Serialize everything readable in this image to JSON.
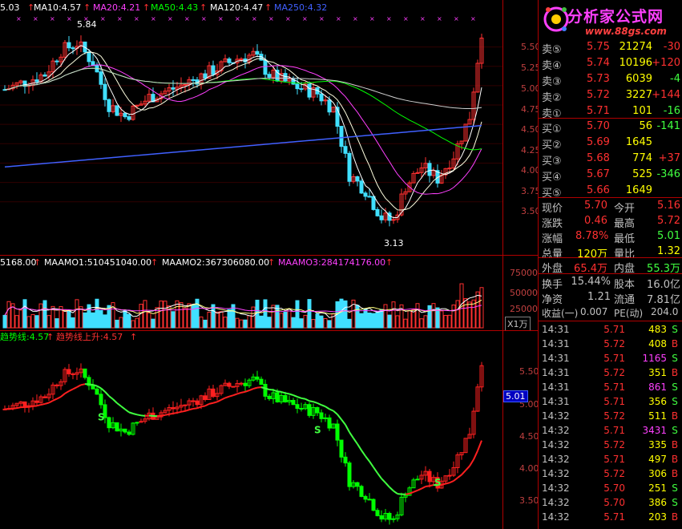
{
  "colors": {
    "up": "#ff3030",
    "down": "#40e0ff",
    "green": "#00ff00",
    "ma5": "#ffffff",
    "ma10": "#ffff00",
    "ma20": "#ff40ff",
    "ma50": "#00ff00",
    "ma120": "#ffffff",
    "ma250": "#4060ff"
  },
  "main_chart": {
    "legend": [
      {
        "label": "5.03",
        "color": "#ffffff"
      },
      {
        "label": "MA10:4.57",
        "color": "#ffffff"
      },
      {
        "label": "MA20:4.21",
        "color": "#ff40ff"
      },
      {
        "label": "MA50:4.43",
        "color": "#00ff00"
      },
      {
        "label": "MA120:4.47",
        "color": "#ffffff"
      },
      {
        "label": "MA250:4.32",
        "color": "#4060ff"
      }
    ],
    "high_marker": "5.84",
    "low_marker": "3.13",
    "axis_ticks": [
      "5.50",
      "5.25",
      "5.00",
      "4.75",
      "4.50",
      "4.25",
      "4.00",
      "3.75",
      "3.50"
    ]
  },
  "volume_chart": {
    "legend": [
      {
        "label": "5168.00",
        "color": "#ffffff"
      },
      {
        "label": "MAAMO1:510451040.00",
        "color": "#ffffff"
      },
      {
        "label": "MAAMO2:367306080.00",
        "color": "#ffffff"
      },
      {
        "label": "MAAMO3:284174176.00",
        "color": "#ff40ff"
      }
    ],
    "axis_ticks": [
      "75000",
      "50000",
      "25000"
    ],
    "unit": "X1万"
  },
  "trend_chart": {
    "legend": [
      {
        "label": "趋势线:4.57",
        "color": "#00ff00"
      },
      {
        "label": "趋势线上升:4.57",
        "color": "#ff3030"
      }
    ],
    "axis_ticks": [
      "5.50",
      "5.00",
      "4.50",
      "4.00",
      "3.50"
    ],
    "current_tag": "5.01",
    "signal_label": "S"
  },
  "logo": {
    "title": "分析家公式网",
    "url": "www.88gs.com"
  },
  "order_book": {
    "asks": [
      {
        "label": "卖⑤",
        "price": "5.75",
        "vol": "21274",
        "chg": "-30"
      },
      {
        "label": "卖④",
        "price": "5.74",
        "vol": "10196",
        "chg": "+120"
      },
      {
        "label": "卖③",
        "price": "5.73",
        "vol": "6039",
        "chg": "-4"
      },
      {
        "label": "卖②",
        "price": "5.72",
        "vol": "3227",
        "chg": "+144"
      },
      {
        "label": "卖①",
        "price": "5.71",
        "vol": "101",
        "chg": "-16"
      }
    ],
    "bids": [
      {
        "label": "买①",
        "price": "5.70",
        "vol": "56",
        "chg": "-141"
      },
      {
        "label": "买②",
        "price": "5.69",
        "vol": "1645",
        "chg": ""
      },
      {
        "label": "买③",
        "price": "5.68",
        "vol": "774",
        "chg": "+37"
      },
      {
        "label": "买④",
        "price": "5.67",
        "vol": "525",
        "chg": "-346"
      },
      {
        "label": "买⑤",
        "price": "5.66",
        "vol": "1649",
        "chg": ""
      }
    ]
  },
  "quote": {
    "rows": [
      {
        "k1": "现价",
        "v1": "5.70",
        "k2": "今开",
        "v2": "5.16"
      },
      {
        "k1": "涨跌",
        "v1": "0.46",
        "k2": "最高",
        "v2": "5.72"
      },
      {
        "k1": "涨幅",
        "v1": "8.78%",
        "k2": "最低",
        "v2": "5.01"
      },
      {
        "k1": "总量",
        "v1": "120万",
        "k2": "量比",
        "v2": "1.32"
      },
      {
        "k1": "外盘",
        "v1": "65.4万",
        "k2": "内盘",
        "v2": "55.3万"
      },
      {
        "k1": "换手",
        "v1": "15.44%",
        "k2": "股本",
        "v2": "16.0亿"
      },
      {
        "k1": "净资",
        "v1": "1.21",
        "k2": "流通",
        "v2": "7.81亿"
      },
      {
        "k1": "收益(一)",
        "v1": "0.007",
        "k2": "PE(动)",
        "v2": "204.0"
      }
    ]
  },
  "ticks": [
    {
      "time": "14:31",
      "price": "5.71",
      "vol": "483",
      "side": "S"
    },
    {
      "time": "14:31",
      "price": "5.72",
      "vol": "408",
      "side": "B"
    },
    {
      "time": "14:31",
      "price": "5.71",
      "vol": "1165",
      "side": "S"
    },
    {
      "time": "14:31",
      "price": "5.72",
      "vol": "351",
      "side": "B"
    },
    {
      "time": "14:31",
      "price": "5.71",
      "vol": "861",
      "side": "S"
    },
    {
      "time": "14:31",
      "price": "5.71",
      "vol": "356",
      "side": "S"
    },
    {
      "time": "14:32",
      "price": "5.72",
      "vol": "511",
      "side": "B"
    },
    {
      "time": "14:32",
      "price": "5.71",
      "vol": "3431",
      "side": "S"
    },
    {
      "time": "14:32",
      "price": "5.72",
      "vol": "335",
      "side": "B"
    },
    {
      "time": "14:32",
      "price": "5.71",
      "vol": "497",
      "side": "B"
    },
    {
      "time": "14:32",
      "price": "5.72",
      "vol": "306",
      "side": "B"
    },
    {
      "time": "14:32",
      "price": "5.70",
      "vol": "251",
      "side": "S"
    },
    {
      "time": "14:32",
      "price": "5.70",
      "vol": "386",
      "side": "S"
    },
    {
      "time": "14:32",
      "price": "5.71",
      "vol": "203",
      "side": "B"
    }
  ]
}
